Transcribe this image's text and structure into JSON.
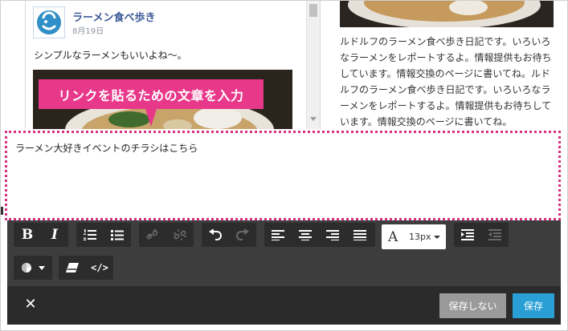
{
  "post": {
    "page_name": "ラーメン食べ歩き",
    "date": "8月19日",
    "text": "シンプルなラーメンもいいよね〜。"
  },
  "right_column": {
    "text": "ルドルフのラーメン食べ歩き日記です。いろいろなラーメンをレポートするよ。情報提供もお待ちしています。情報交換のページに書いてね。ルドルフのラーメン食べ歩き日記です。いろいろなラーメンをレポートするよ。情報提供もお待ちしています。情報交換のページに書いてね。"
  },
  "callout": {
    "text": "リンクを貼るための文章を入力"
  },
  "editor": {
    "value": "ラーメン大好きイベントのチラシはこちら",
    "font_size": "13px"
  },
  "footer": {
    "close_label": "✕",
    "cancel_label": "保存しない",
    "save_label": "保存"
  },
  "icons": {
    "bold": "B",
    "italic": "I",
    "ordered_list": "ordered-list-icon",
    "bullet_list": "bullet-list-icon",
    "link": "link-icon",
    "unlink": "unlink-icon",
    "undo": "undo-icon",
    "redo": "redo-icon",
    "align_left": "align-left-icon",
    "align_center": "align-center-icon",
    "align_right": "align-right-icon",
    "justify": "justify-icon",
    "font_size": "A",
    "indent": "indent-icon",
    "outdent": "outdent-icon",
    "color": "color-icon",
    "eraser": "eraser-icon",
    "code": "</>"
  },
  "colors": {
    "callout": "#e8388a",
    "highlight_border": "#d6307f",
    "toolbar": "#3d3d3d",
    "footer": "#2b2b2b",
    "save_button": "#2a9fd6",
    "cancel_button": "#9a9a9a",
    "page_link": "#3b5998"
  }
}
